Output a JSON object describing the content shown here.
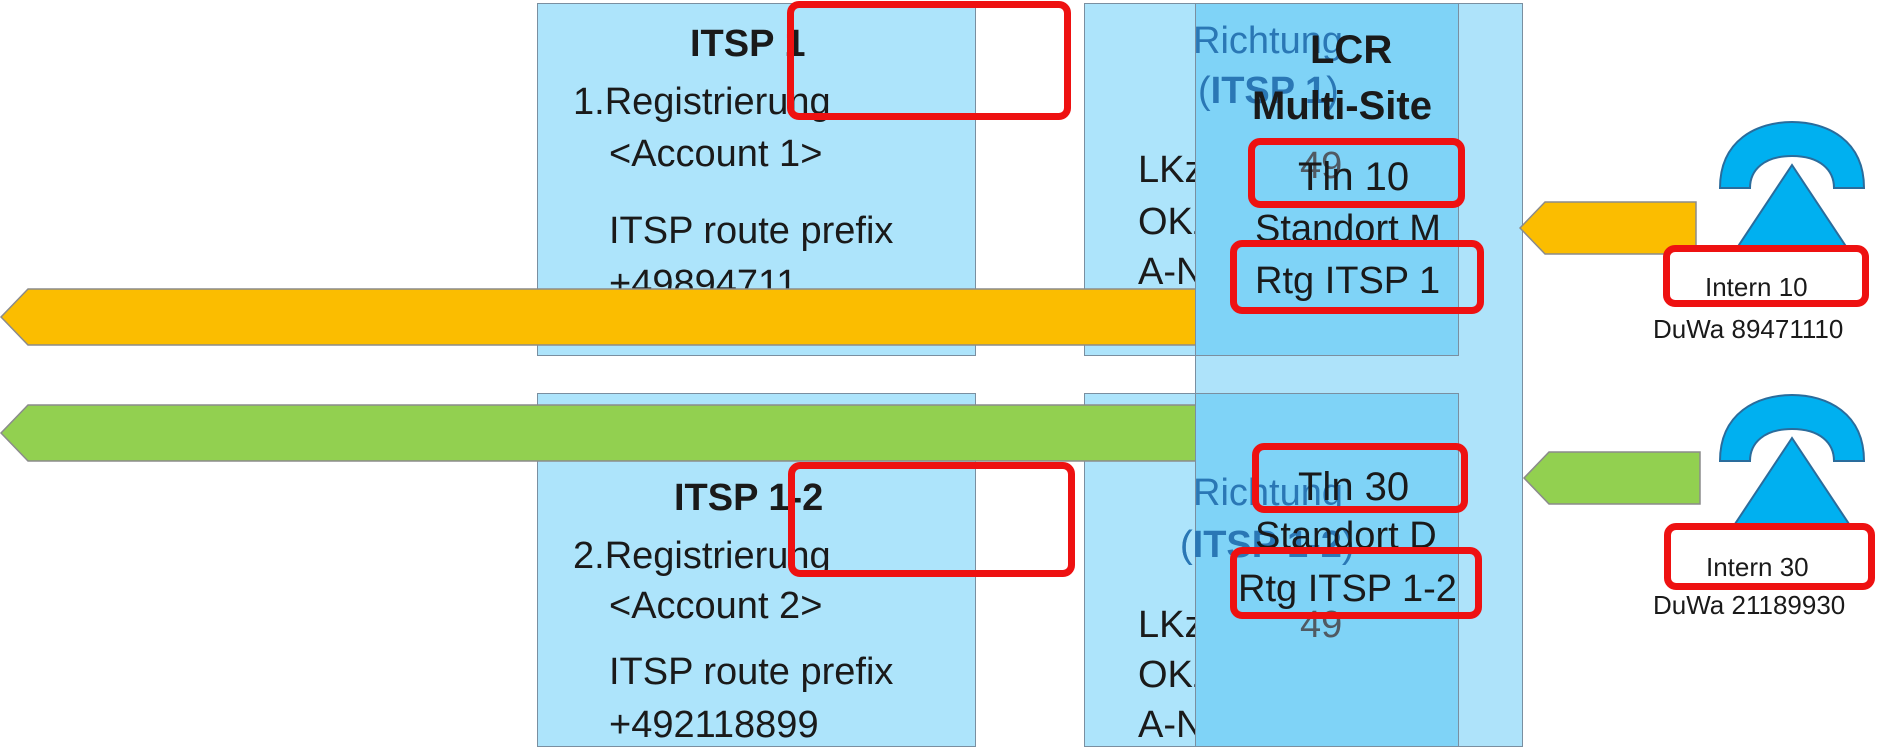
{
  "itsp1": {
    "title": "ITSP 1",
    "registration": "1.Registrierung",
    "account": "<Account 1>",
    "prefix_label": "ITSP route prefix",
    "prefix_value": "+49894711"
  },
  "itsp2": {
    "title": "ITSP 1-2",
    "registration": "2.Registrierung",
    "account": "<Account 2>",
    "prefix_label": "ITSP route prefix",
    "prefix_value": "+492118899"
  },
  "richtung1": {
    "line1": "Richtung",
    "line2_open": "(",
    "line2_bold": "ITSP 1",
    "line2_close": ")",
    "lkz": "LKz",
    "lkz_value": "49",
    "okz": "OKz",
    "anr": "A-Nr."
  },
  "richtung2": {
    "line1": "Richtung",
    "line2_open": "(",
    "line2_bold": "ITSP 1-2",
    "line2_close": ")",
    "lkz": "LKz",
    "lkz_value": "49",
    "okz": "OKz",
    "anr": "A-Nr."
  },
  "lcr": {
    "line1": "LCR",
    "line2": "Multi-Site",
    "tln10": "Tln 10",
    "standort_m": "Standort M",
    "rtg1": "Rtg ITSP 1",
    "tln30": "Tln 30",
    "standort_d": "Standort D",
    "rtg2": "Rtg ITSP 1-2"
  },
  "phone1": {
    "label": "Intern 10",
    "duwa": "DuWa 89471110"
  },
  "phone2": {
    "label": "Intern 30",
    "duwa": "DuWa 21189930"
  },
  "colors": {
    "box_fill": "#ade4fb",
    "lcr_fill": "#7fd3f7",
    "highlight": "#ee1111",
    "orange": "#fbbd00",
    "green": "#92d050",
    "phone": "#00b0f0"
  }
}
